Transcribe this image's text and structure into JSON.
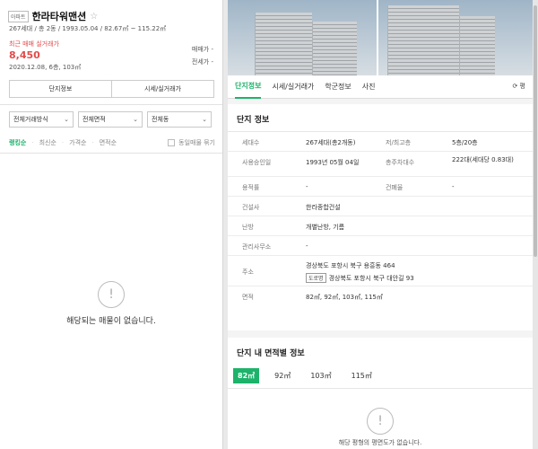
{
  "complex": {
    "type_tag": "아파트",
    "name": "한라타워맨션",
    "summary": "267세대 / 총 2동 / 1993.05.04 / 82.67㎡ ~ 115.22㎡",
    "recent_label": "최근 매매 실거래가",
    "recent_price": "8,450",
    "recent_date": "2020.12.08, 6층, 103㎡",
    "side_sale": "매매가 -",
    "side_jeonse": "전세가 -"
  },
  "buttons": {
    "info": "단지정보",
    "market": "시세/실거래가"
  },
  "filters": {
    "trade": "전체거래방식",
    "area": "전체면적",
    "dong": "전체동"
  },
  "sort": {
    "items": [
      "랭킹순",
      "최신순",
      "가격순",
      "면적순"
    ],
    "same_listing": "동일매물 묶기"
  },
  "empty_listing": "해당되는 매물이 없습니다.",
  "tabs": [
    "단지정보",
    "시세/실거래가",
    "학군정보",
    "사진"
  ],
  "tab_more": "⟳ 평",
  "info_card": {
    "title": "단지 정보",
    "rows": {
      "households_k": "세대수",
      "households_v": "267세대(총2개동)",
      "floors_k": "저/최고층",
      "floors_v": "5층/20층",
      "approval_k": "사용승인일",
      "approval_v": "1993년 05월 04일",
      "parking_k": "총주차대수",
      "parking_v": "222대(세대당 0.83대)",
      "far_k": "용적률",
      "far_v": "-",
      "bcr_k": "건폐율",
      "bcr_v": "-",
      "builder_k": "건설사",
      "builder_v": "한라종합건설",
      "heating_k": "난방",
      "heating_v": "개별난방, 기름",
      "office_k": "관리사무소",
      "office_v": "-",
      "address_k": "주소",
      "address_v": "경상북도 포항시 북구 용흥동 464",
      "road_tag": "도로명",
      "road_v": "경상북도 포항시 북구 대안길 93",
      "area_k": "면적",
      "area_v": "82㎡, 92㎡, 103㎡, 115㎡"
    }
  },
  "area_card": {
    "title": "단지 내 면적별 정보",
    "tabs": [
      "82㎡",
      "92㎡",
      "103㎡",
      "115㎡"
    ],
    "empty": "해당 평형의 평면도가 없습니다."
  },
  "colors": {
    "accent": "#1db36a",
    "price": "#e34b4b"
  }
}
